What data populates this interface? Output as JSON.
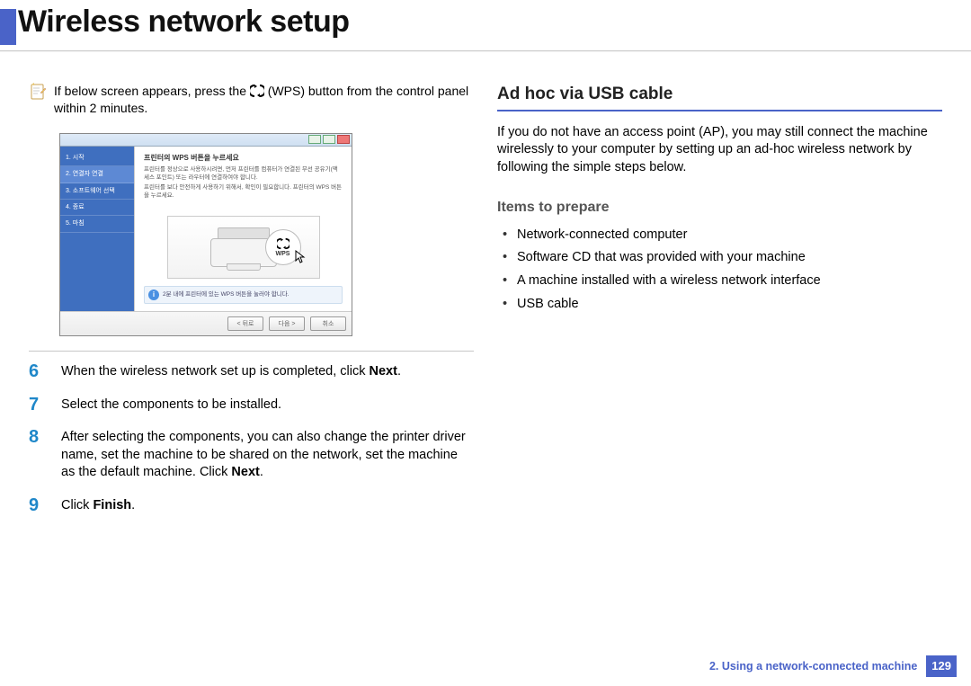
{
  "title": "Wireless network setup",
  "note": {
    "pre": "If below screen appears, press the ",
    "wps_label": " (WPS) button from the control panel within 2 minutes."
  },
  "screenshot": {
    "sidebar": [
      "1. 시작",
      "2. 연결자 연결",
      "3. 소프트웨어 선택",
      "4. 종료",
      "5. 마침"
    ],
    "main_title": "프린터의 WPS 버튼을 누르세요",
    "main_line1": "프린터를 정상으로 사용하시려면, 먼저 프린터를 컴퓨터가 연결된 무선 공유기(액세스 포인트) 또는 라우터에 연결하여야 합니다.",
    "main_line2": "프린터를 보다 안전하게 사용하기 위해서, 확인이 필요합니다. 프린터의 WPS 버튼을 누르세요.",
    "wps_badge": "WPS",
    "info": "2분 내에 프린터에 있는 WPS 버튼을 눌러야 합니다.",
    "buttons": [
      "< 뒤로",
      "다음 >",
      "취소"
    ]
  },
  "steps": [
    {
      "num": "6",
      "pre": "When the wireless network set up is completed, click ",
      "bold": "Next",
      "post": "."
    },
    {
      "num": "7",
      "pre": "Select the components to be installed.",
      "bold": "",
      "post": ""
    },
    {
      "num": "8",
      "pre": "After selecting the components, you can also change the printer driver name, set the machine to be shared on the network, set the machine as the default machine. Click ",
      "bold": "Next",
      "post": "."
    },
    {
      "num": "9",
      "pre": "Click ",
      "bold": "Finish",
      "post": "."
    }
  ],
  "right": {
    "heading": "Ad hoc via USB cable",
    "para": "If you do not have an access point (AP), you may still connect the machine wirelessly to your computer by setting up an ad-hoc wireless network by following the simple steps below.",
    "subheading": "Items to prepare",
    "items": [
      "Network-connected computer",
      "Software CD that was provided with your machine",
      "A machine installed with a wireless network interface",
      "USB cable"
    ]
  },
  "footer": {
    "chapter": "2.  Using a network-connected machine",
    "page": "129"
  }
}
